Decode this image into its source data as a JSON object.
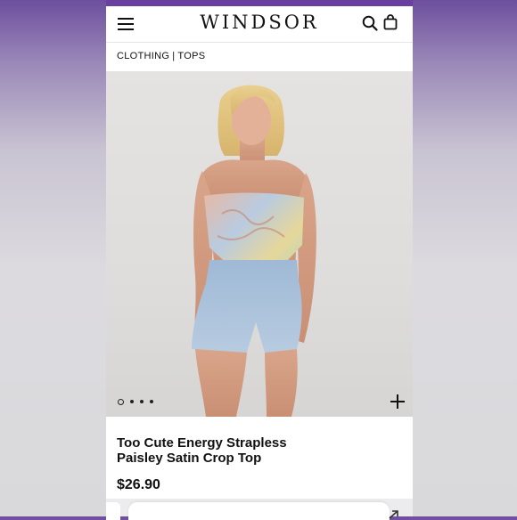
{
  "header": {
    "logo": "WINDSOR",
    "menu_icon": "hamburger-menu-icon",
    "search_icon": "search-icon",
    "bag_icon": "shopping-bag-icon",
    "brand_color": "#6a3fa0"
  },
  "breadcrumb": {
    "items": [
      "CLOTHING",
      "TOPS"
    ],
    "separator": "|"
  },
  "gallery": {
    "image_count": 4,
    "active_index": 0,
    "add_icon": "plus-icon"
  },
  "product": {
    "title_line1": "Too Cute Energy Strapless",
    "title_line2": "Paisley Satin Crop Top",
    "price": "$26.90"
  },
  "bottom_bar": {
    "arrow_icon": "arrow-icon"
  }
}
